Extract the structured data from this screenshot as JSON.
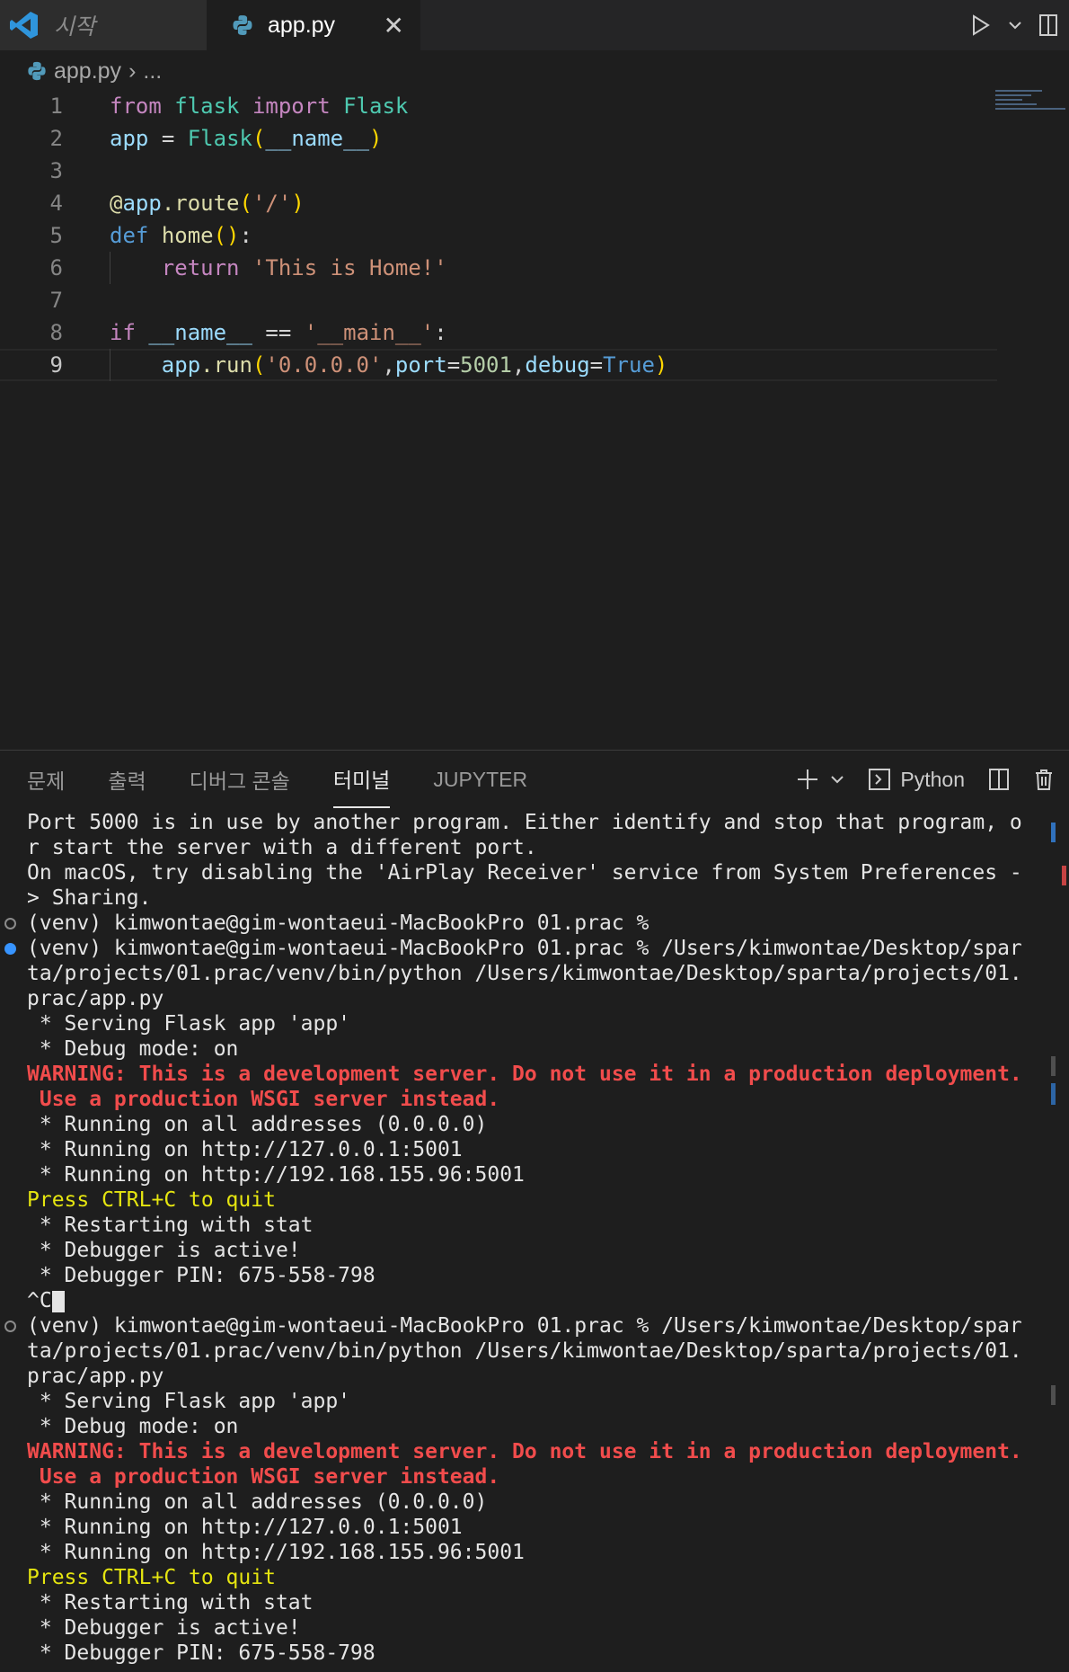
{
  "tabs": [
    {
      "label": "시작",
      "icon": "vscode-icon"
    },
    {
      "label": "app.py",
      "icon": "python-icon"
    }
  ],
  "breadcrumb": {
    "file": "app.py",
    "rest": "..."
  },
  "code": [
    {
      "n": "1",
      "html": "<span class=\"kw\">from</span> <span class=\"cls\">flask</span> <span class=\"kw\">import</span> <span class=\"cls\">Flask</span>"
    },
    {
      "n": "2",
      "html": "<span class=\"var\">app</span> <span class=\"op\">=</span> <span class=\"cls\">Flask</span><span class=\"par\">(</span><span class=\"var\">__name__</span><span class=\"par\">)</span>"
    },
    {
      "n": "3",
      "html": ""
    },
    {
      "n": "4",
      "html": "<span class=\"fn\">@</span><span class=\"var\">app</span><span class=\"fn\">.route</span><span class=\"par\">(</span><span class=\"str\">'/'</span><span class=\"par\">)</span>"
    },
    {
      "n": "5",
      "html": "<span class=\"kw2\">def</span> <span class=\"fn\">home</span><span class=\"par\">()</span><span class=\"op\">:</span>"
    },
    {
      "n": "6",
      "html": "    <span class=\"kw\">return</span> <span class=\"str\">'This is Home!'</span>"
    },
    {
      "n": "7",
      "html": ""
    },
    {
      "n": "8",
      "html": "<span class=\"kw\">if</span> <span class=\"var\">__name__</span> <span class=\"op\">==</span> <span class=\"str\">'__main__'</span><span class=\"op\">:</span>"
    },
    {
      "n": "9",
      "html": "    <span class=\"var\">app</span><span class=\"fn\">.run</span><span class=\"par\">(</span><span class=\"str\">'0.0.0.0'</span><span class=\"op\">,</span><span class=\"var\">port</span><span class=\"op\">=</span><span class=\"num\">5001</span><span class=\"op\">,</span><span class=\"var\">debug</span><span class=\"op\">=</span><span class=\"kw2\">True</span><span class=\"par\">)</span>"
    }
  ],
  "panel_tabs": [
    "문제",
    "출력",
    "디버그 콘솔",
    "터미널",
    "JUPYTER"
  ],
  "panel_active": "터미널",
  "panel_actions": {
    "new_label": "+",
    "shell_label": "Python"
  },
  "terminal": [
    {
      "t": "Port 5000 is in use by another program. Either identify and stop that program, o",
      "c": ""
    },
    {
      "t": "r start the server with a different port.",
      "c": ""
    },
    {
      "t": "On macOS, try disabling the 'AirPlay Receiver' service from System Preferences -",
      "c": ""
    },
    {
      "t": "> Sharing.",
      "c": ""
    },
    {
      "t": "(venv) kimwontae@gim-wontaeui-MacBookPro 01.prac % ",
      "c": "",
      "dot": "hollow"
    },
    {
      "t": "(venv) kimwontae@gim-wontaeui-MacBookPro 01.prac % /Users/kimwontae/Desktop/spar",
      "c": "",
      "dot": "filled"
    },
    {
      "t": "ta/projects/01.prac/venv/bin/python /Users/kimwontae/Desktop/sparta/projects/01.",
      "c": ""
    },
    {
      "t": "prac/app.py",
      "c": ""
    },
    {
      "t": " * Serving Flask app 'app'",
      "c": ""
    },
    {
      "t": " * Debug mode: on",
      "c": ""
    },
    {
      "t": "WARNING: This is a development server. Do not use it in a production deployment.",
      "c": "warn"
    },
    {
      "t": " Use a production WSGI server instead.",
      "c": "warn"
    },
    {
      "t": " * Running on all addresses (0.0.0.0)",
      "c": ""
    },
    {
      "t": " * Running on http://127.0.0.1:5001",
      "c": ""
    },
    {
      "t": " * Running on http://192.168.155.96:5001",
      "c": ""
    },
    {
      "t": "Press CTRL+C to quit",
      "c": "yel"
    },
    {
      "t": " * Restarting with stat",
      "c": ""
    },
    {
      "t": " * Debugger is active!",
      "c": ""
    },
    {
      "t": " * Debugger PIN: 675-558-798",
      "c": ""
    },
    {
      "t": "^C",
      "c": "",
      "cursor": true
    },
    {
      "t": "(venv) kimwontae@gim-wontaeui-MacBookPro 01.prac % /Users/kimwontae/Desktop/spar",
      "c": "",
      "dot": "hollow"
    },
    {
      "t": "ta/projects/01.prac/venv/bin/python /Users/kimwontae/Desktop/sparta/projects/01.",
      "c": ""
    },
    {
      "t": "prac/app.py",
      "c": ""
    },
    {
      "t": " * Serving Flask app 'app'",
      "c": ""
    },
    {
      "t": " * Debug mode: on",
      "c": ""
    },
    {
      "t": "WARNING: This is a development server. Do not use it in a production deployment.",
      "c": "warn"
    },
    {
      "t": " Use a production WSGI server instead.",
      "c": "warn"
    },
    {
      "t": " * Running on all addresses (0.0.0.0)",
      "c": ""
    },
    {
      "t": " * Running on http://127.0.0.1:5001",
      "c": ""
    },
    {
      "t": " * Running on http://192.168.155.96:5001",
      "c": ""
    },
    {
      "t": "Press CTRL+C to quit",
      "c": "yel"
    },
    {
      "t": " * Restarting with stat",
      "c": ""
    },
    {
      "t": " * Debugger is active!",
      "c": ""
    },
    {
      "t": " * Debugger PIN: 675-558-798",
      "c": ""
    }
  ],
  "colors": {
    "accent": "#3794ff",
    "warning": "#f14c4c",
    "yellow": "#e5e510",
    "bg": "#1e1e1e"
  }
}
